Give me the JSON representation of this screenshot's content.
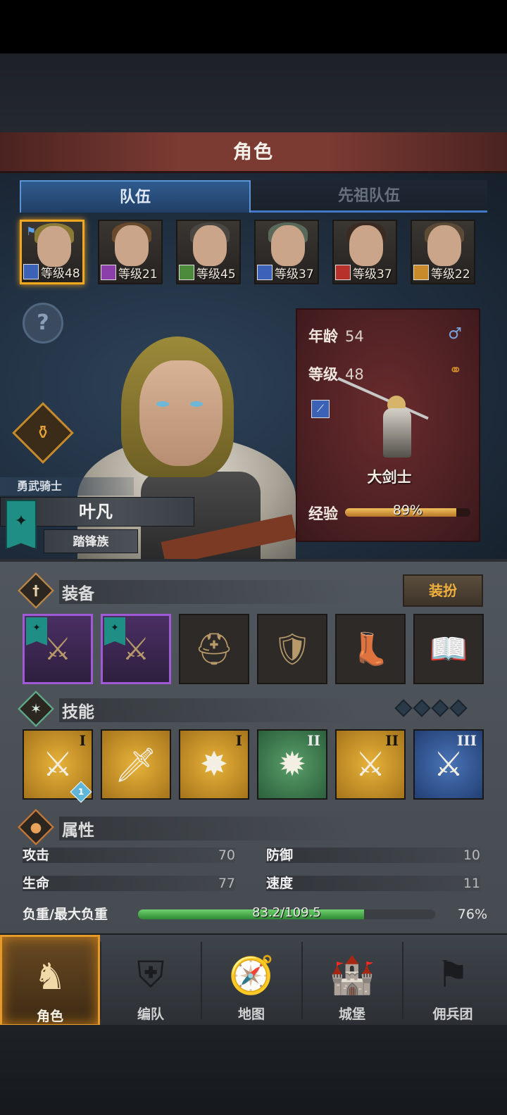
{
  "page_title": "角色",
  "tabs": {
    "party": "队伍",
    "ancestors": "先祖队伍"
  },
  "members": [
    {
      "level": "等级48",
      "class_icon": "greatsword-icon",
      "class_color": "#3c62b8",
      "hair": "#8a7a36",
      "selected": true
    },
    {
      "level": "等级21",
      "class_icon": "staff-icon",
      "class_color": "#8b3fa8",
      "hair": "#6a4a2c",
      "selected": false
    },
    {
      "level": "等级45",
      "class_icon": "crossbow-icon",
      "class_color": "#4c8a3c",
      "hair": "#4a4642",
      "selected": false
    },
    {
      "level": "等级37",
      "class_icon": "sword-icon",
      "class_color": "#3c62b8",
      "hair": "#5a6a5a",
      "selected": false
    },
    {
      "level": "等级37",
      "class_icon": "house-icon",
      "class_color": "#b8302a",
      "hair": "#3a2a22",
      "selected": false
    },
    {
      "level": "等级22",
      "class_icon": "shield-icon",
      "class_color": "#c88a2a",
      "hair": "#5a4a36",
      "selected": false
    }
  ],
  "hero": {
    "title": "勇武骑士",
    "name": "叶凡",
    "clan": "踏锋族",
    "age_label": "年龄",
    "age": "54",
    "level_label": "等级",
    "level": "48",
    "class_name": "大剑士",
    "exp_label": "经验",
    "exp_percent_text": "89%",
    "exp_fraction": 0.89
  },
  "equipment": {
    "title": "装备",
    "dress_button": "装扮",
    "slots": [
      {
        "icon": "crossed-swords-icon",
        "rarity": "purple",
        "glyph": "⚔"
      },
      {
        "icon": "crossed-swords-icon",
        "rarity": "purple",
        "glyph": "⚔"
      },
      {
        "icon": "helmet-icon",
        "rarity": "common",
        "glyph": "⛑"
      },
      {
        "icon": "armor-icon",
        "rarity": "common",
        "glyph": "🛡"
      },
      {
        "icon": "boots-icon",
        "rarity": "common",
        "glyph": "👢"
      },
      {
        "icon": "book-icon",
        "rarity": "common",
        "glyph": "📖"
      }
    ]
  },
  "skills": {
    "title": "技能",
    "items": [
      {
        "icon": "sword-strike-skill-icon",
        "style": "gold",
        "rank": "I",
        "badge": "1",
        "glyph": "⚔"
      },
      {
        "icon": "sword-ward-skill-icon",
        "style": "gold",
        "rank": "",
        "badge": "",
        "glyph": "🗡"
      },
      {
        "icon": "burst-strike-skill-icon",
        "style": "gold",
        "rank": "I",
        "badge": "",
        "glyph": "✸"
      },
      {
        "icon": "explosion-skill-icon",
        "style": "green",
        "rank": "II",
        "badge": "",
        "glyph": "✹"
      },
      {
        "icon": "cross-blades-skill-icon",
        "style": "gold",
        "rank": "II",
        "badge": "",
        "glyph": "⚔"
      },
      {
        "icon": "cross-blades-skill-icon",
        "style": "blue",
        "rank": "III",
        "badge": "",
        "glyph": "⚔"
      }
    ]
  },
  "attributes": {
    "title": "属性",
    "attack_label": "攻击",
    "attack": "70",
    "defense_label": "防御",
    "defense": "10",
    "hp_label": "生命",
    "hp": "77",
    "speed_label": "速度",
    "speed": "11",
    "load_label": "负重/最大负重",
    "load_text": "83.2/109.5",
    "load_fraction": 0.76,
    "load_percent": "76%"
  },
  "nav": [
    {
      "label": "角色",
      "icon": "knight-icon",
      "active": true,
      "glyph": "♞"
    },
    {
      "label": "编队",
      "icon": "helmet-formation-icon",
      "active": false,
      "glyph": "⛨"
    },
    {
      "label": "地图",
      "icon": "compass-icon",
      "active": false,
      "glyph": "🧭"
    },
    {
      "label": "城堡",
      "icon": "castle-icon",
      "active": false,
      "glyph": "🏰"
    },
    {
      "label": "佣兵团",
      "icon": "mercenary-banner-icon",
      "active": false,
      "glyph": "⚑"
    }
  ]
}
